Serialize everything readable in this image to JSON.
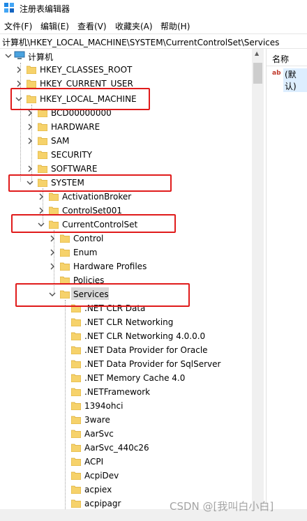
{
  "window": {
    "title": "注册表编辑器",
    "icon": "registry-editor-icon"
  },
  "menu": [
    "文件(F)",
    "编辑(E)",
    "查看(V)",
    "收藏夹(A)",
    "帮助(H)"
  ],
  "address": "计算机\\HKEY_LOCAL_MACHINE\\SYSTEM\\CurrentControlSet\\Services",
  "tree": [
    {
      "label": "计算机",
      "icon": "computer-icon",
      "expanded": true
    },
    {
      "label": "HKEY_CLASSES_ROOT"
    },
    {
      "label": "HKEY_CURRENT_USER"
    },
    {
      "label": "HKEY_LOCAL_MACHINE",
      "expanded": true,
      "highlighted": true
    },
    {
      "label": "BCD00000000"
    },
    {
      "label": "HARDWARE"
    },
    {
      "label": "SAM"
    },
    {
      "label": "SECURITY"
    },
    {
      "label": "SOFTWARE"
    },
    {
      "label": "SYSTEM",
      "expanded": true,
      "highlighted": true
    },
    {
      "label": "ActivationBroker"
    },
    {
      "label": "ControlSet001"
    },
    {
      "label": "CurrentControlSet",
      "expanded": true,
      "highlighted": true
    },
    {
      "label": "Control"
    },
    {
      "label": "Enum"
    },
    {
      "label": "Hardware Profiles"
    },
    {
      "label": "Policies"
    },
    {
      "label": "Services",
      "expanded": true,
      "selected": true,
      "highlighted": true
    },
    {
      "label": ".NET CLR Data"
    },
    {
      "label": ".NET CLR Networking"
    },
    {
      "label": ".NET CLR Networking 4.0.0.0"
    },
    {
      "label": ".NET Data Provider for Oracle"
    },
    {
      "label": ".NET Data Provider for SqlServer"
    },
    {
      "label": ".NET Memory Cache 4.0"
    },
    {
      "label": ".NETFramework"
    },
    {
      "label": "1394ohci"
    },
    {
      "label": "3ware"
    },
    {
      "label": "AarSvc"
    },
    {
      "label": "AarSvc_440c26"
    },
    {
      "label": "ACPI"
    },
    {
      "label": "AcpiDev"
    },
    {
      "label": "acpiex"
    },
    {
      "label": "acpipagr"
    }
  ],
  "values_pane": {
    "column_header": "名称",
    "values": [
      {
        "name": "(默认)",
        "icon": "string-value-icon"
      }
    ]
  },
  "watermark": "CSDN @[我叫白小白]",
  "colors": {
    "highlight_box": "#e01b1b",
    "folder": "#f6d26b",
    "selection": "#d9d9d9"
  }
}
